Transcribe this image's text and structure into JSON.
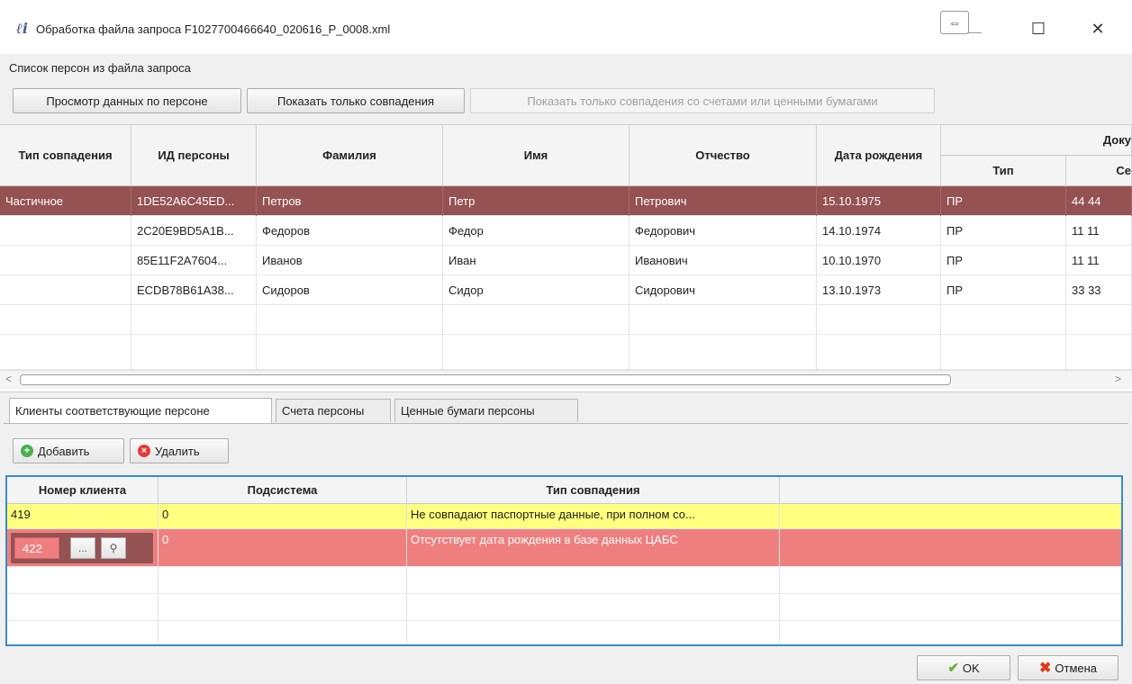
{
  "window": {
    "title": "Обработка файла запроса F1027700466640_020616_P_0008.xml",
    "icon_text": "ℓi",
    "resize_symbol": "⇔",
    "maximize_symbol": "☐",
    "close_symbol": "✕"
  },
  "section_label": "Список персон из файла запроса",
  "toolbar": {
    "view_person": "Просмотр данных по персоне",
    "show_matches": "Показать только совпадения",
    "show_matches_accounts": "Показать только совпадения со счетами или ценными бумагами"
  },
  "persons_grid": {
    "headers": {
      "match_type": "Тип совпадения",
      "person_id": "ИД персоны",
      "last_name": "Фамилия",
      "first_name": "Имя",
      "patronymic": "Отчество",
      "birth_date": "Дата рождения",
      "document_group": "Доку",
      "doc_type": "Тип",
      "doc_series": "Се"
    },
    "rows": [
      {
        "match_type": "Частичное",
        "person_id": "1DE52A6C45ED...",
        "last_name": "Петров",
        "first_name": "Петр",
        "patronymic": "Петрович",
        "birth_date": "15.10.1975",
        "doc_type": "ПР",
        "doc_series": "44 44"
      },
      {
        "match_type": "",
        "person_id": "2C20E9BD5A1B...",
        "last_name": "Федоров",
        "first_name": "Федор",
        "patronymic": "Федорович",
        "birth_date": "14.10.1974",
        "doc_type": "ПР",
        "doc_series": "11 11"
      },
      {
        "match_type": "",
        "person_id": "85E11F2A7604...",
        "last_name": "Иванов",
        "first_name": "Иван",
        "patronymic": "Иванович",
        "birth_date": "10.10.1970",
        "doc_type": "ПР",
        "doc_series": "11 11"
      },
      {
        "match_type": "",
        "person_id": "ECDB78B61A38...",
        "last_name": "Сидоров",
        "first_name": "Сидор",
        "patronymic": "Сидорович",
        "birth_date": "13.10.1973",
        "doc_type": "ПР",
        "doc_series": "33 33"
      }
    ],
    "scroll_left": "<",
    "scroll_right": ">"
  },
  "tabs": [
    {
      "label": "Клиенты соответствующие персоне"
    },
    {
      "label": "Счета персоны"
    },
    {
      "label": "Ценные бумаги персоны"
    }
  ],
  "clients_toolbar": {
    "add": "Добавить",
    "add_icon": "+",
    "delete": "Удалить",
    "delete_icon": "×"
  },
  "clients_grid": {
    "headers": {
      "client_number": "Номер клиента",
      "subsystem": "Подсистема",
      "match_type": "Тип совпадения"
    },
    "rows": [
      {
        "client_number": "419",
        "subsystem": "0",
        "match_type": "Не совпадают паспортные данные, при полном со..."
      },
      {
        "client_number": "422",
        "subsystem": "0",
        "match_type": "Отсутствует дата рождения в базе данных ЦАБС"
      }
    ],
    "ellipsis_button": "...",
    "search_symbol": "⚲"
  },
  "footer": {
    "ok": "OK",
    "ok_icon": "✔",
    "cancel": "Отмена",
    "cancel_icon": "✖"
  },
  "colors": {
    "selected_row": "#955252",
    "row_yellow": "#ffff7f",
    "row_red": "#ef7f7f",
    "grid_focus": "#3a8cc8"
  }
}
